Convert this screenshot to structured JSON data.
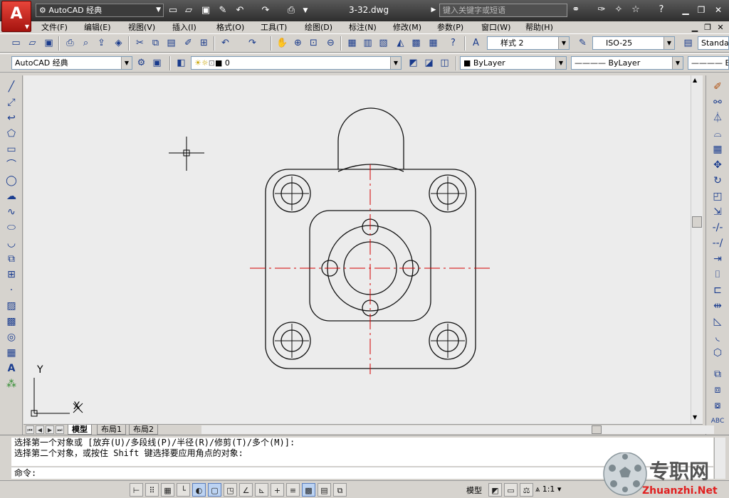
{
  "app": {
    "logo_letter": "A",
    "workspace": "AutoCAD 经典",
    "document_title": "3-32.dwg",
    "search_placeholder": "键入关键字或短语"
  },
  "menu": {
    "items": [
      "文件(F)",
      "编辑(E)",
      "视图(V)",
      "插入(I)",
      "格式(O)",
      "工具(T)",
      "绘图(D)",
      "标注(N)",
      "修改(M)",
      "参数(P)",
      "窗口(W)",
      "帮助(H)"
    ]
  },
  "styles_toolbar": {
    "text_style": "样式 2",
    "dim_style": "ISO-25",
    "table_style": "Standa"
  },
  "layers_toolbar": {
    "workspace": "AutoCAD 经典",
    "layer": "0",
    "color": "ByLayer",
    "linetype": "ByLayer",
    "lineweight": "B"
  },
  "canvas": {
    "ucs_y_label": "Y",
    "ucs_x_label": "X"
  },
  "layout_tabs": [
    "模型",
    "布局1",
    "布局2"
  ],
  "command": {
    "history": [
      "选择第一个对象或 [放弃(U)/多段线(P)/半径(R)/修剪(T)/多个(M)]:",
      "选择第二个对象，或按住 Shift 键选择要应用角点的对象:"
    ],
    "prompt": "命令:"
  },
  "status": {
    "model_label": "模型",
    "scale_label": "1:1"
  },
  "watermark": {
    "cn": "专职网",
    "en": "Zhuanzhi.Net"
  },
  "colors": {
    "title_bg": "#3a3a3a",
    "canvas_bg": "#ececec",
    "centerline": "#d40000",
    "logo_red": "#c8201a"
  }
}
